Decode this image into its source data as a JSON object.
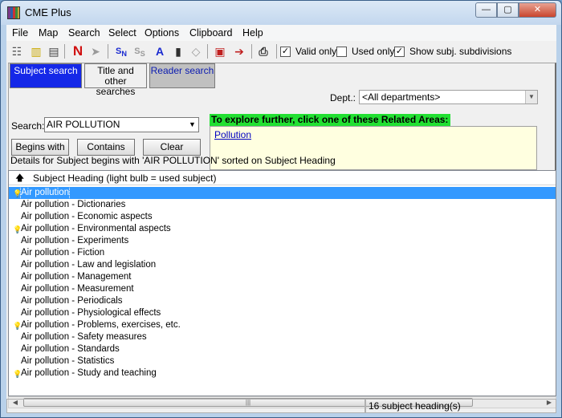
{
  "window": {
    "title": "CME Plus",
    "minimize": "—",
    "maximize": "▢",
    "close": "✕"
  },
  "menu": [
    "File",
    "Map",
    "Search",
    "Select",
    "Options",
    "Clipboard",
    "Help"
  ],
  "toolbar": {
    "checkboxes": [
      {
        "label": "Valid only",
        "checked": true
      },
      {
        "label": "Used only",
        "checked": false
      },
      {
        "label": "Show subj. subdivisions",
        "checked": true
      }
    ]
  },
  "tabs": {
    "subject": "Subject search",
    "title": "Title and other searches",
    "reader": "Reader search"
  },
  "dept": {
    "label": "Dept.:",
    "value": "<All departments>"
  },
  "search": {
    "label": "Search:",
    "value": "AIR POLLUTION"
  },
  "buttons": {
    "begins": "Begins with",
    "contains": "Contains",
    "clear": "Clear"
  },
  "related": {
    "header": "To explore further, click one of these Related Areas:",
    "links": [
      "Pollution"
    ]
  },
  "details": "Details for Subject begins with 'AIR POLLUTION' sorted on Subject Heading",
  "list": {
    "header": "Subject Heading   (light bulb = used subject)",
    "rows": [
      {
        "text": "Air pollution",
        "used": true,
        "selected": true
      },
      {
        "text": "Air pollution - Dictionaries",
        "used": false
      },
      {
        "text": "Air pollution - Economic aspects",
        "used": false
      },
      {
        "text": "Air pollution - Environmental aspects",
        "used": true
      },
      {
        "text": "Air pollution - Experiments",
        "used": false
      },
      {
        "text": "Air pollution - Fiction",
        "used": false
      },
      {
        "text": "Air pollution - Law and legislation",
        "used": false
      },
      {
        "text": "Air pollution - Management",
        "used": false
      },
      {
        "text": "Air pollution - Measurement",
        "used": false
      },
      {
        "text": "Air pollution - Periodicals",
        "used": false
      },
      {
        "text": "Air pollution - Physiological effects",
        "used": false
      },
      {
        "text": "Air pollution - Problems, exercises, etc.",
        "used": true
      },
      {
        "text": "Air pollution - Safety measures",
        "used": false
      },
      {
        "text": "Air pollution - Standards",
        "used": false
      },
      {
        "text": "Air pollution - Statistics",
        "used": false
      },
      {
        "text": "Air pollution - Study and teaching",
        "used": true
      }
    ]
  },
  "status": {
    "count": "16 subject heading(s)"
  },
  "icons": {
    "bulb": "light-bulb-icon"
  }
}
